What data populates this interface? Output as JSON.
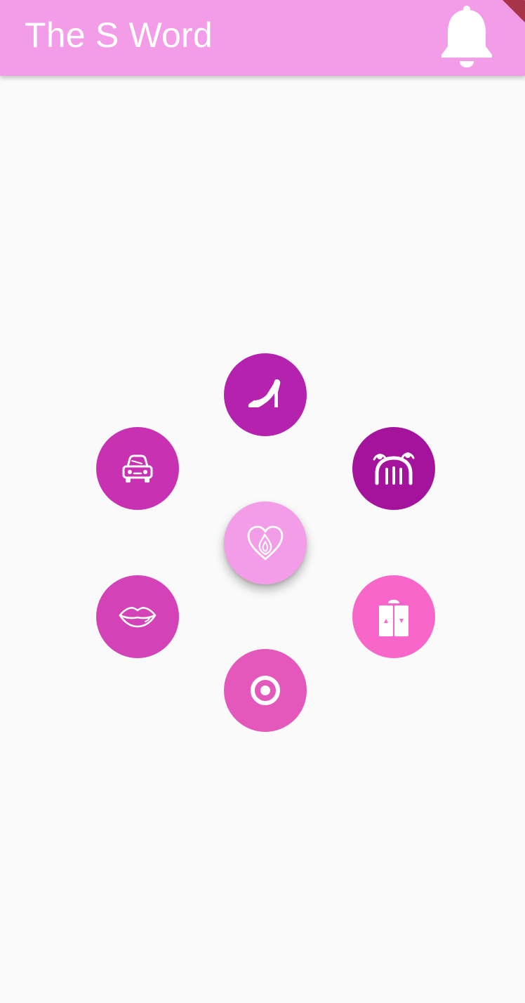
{
  "app_bar": {
    "title": "The S Word",
    "background_color": "#f39ce8",
    "action_icon": "bell-icon"
  },
  "menu": {
    "center": {
      "icon": "heart-flame-icon",
      "color": "#f39ce8"
    },
    "items": [
      {
        "icon": "high-heel-icon",
        "color": "#b522ad"
      },
      {
        "icon": "canopy-bed-icon",
        "color": "#a5129c"
      },
      {
        "icon": "elevator-icon",
        "color": "#f766c8"
      },
      {
        "icon": "target-icon",
        "color": "#e457bb"
      },
      {
        "icon": "lips-icon",
        "color": "#d342b6"
      },
      {
        "icon": "car-icon",
        "color": "#c832b2"
      }
    ]
  },
  "page_background": "#fafafa"
}
